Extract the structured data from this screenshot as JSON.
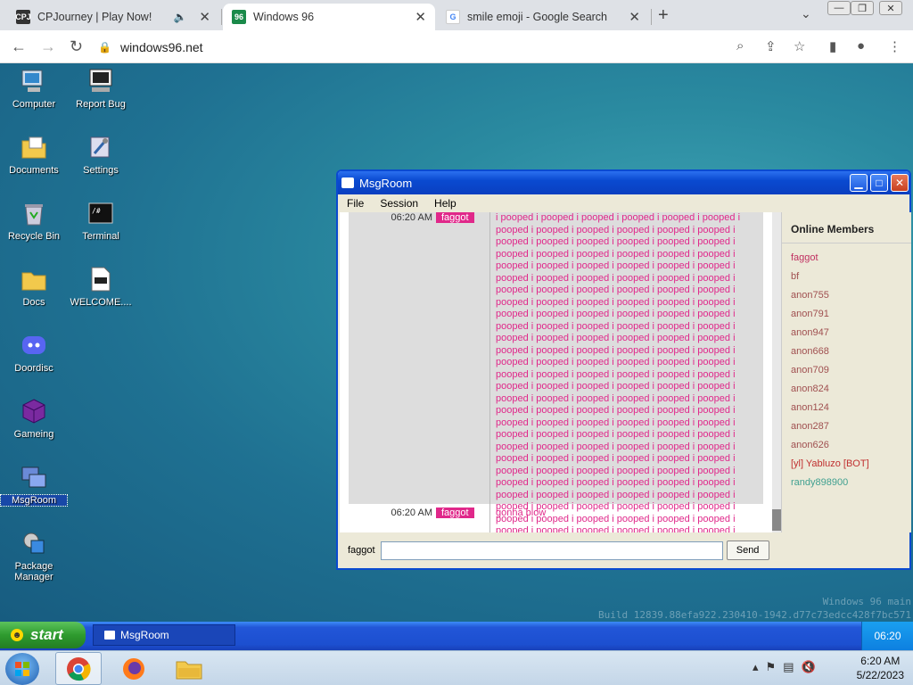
{
  "browser": {
    "tabs": [
      {
        "title": "CPJourney | Play Now!",
        "favicon": "CPJ",
        "audio": true
      },
      {
        "title": "Windows 96",
        "favicon": "96",
        "active": true
      },
      {
        "title": "smile emoji - Google Search",
        "favicon": "G"
      }
    ],
    "url": "windows96.net"
  },
  "desktop": {
    "icons": [
      {
        "label": "Computer"
      },
      {
        "label": "Report Bug"
      },
      {
        "label": "Documents"
      },
      {
        "label": "Settings"
      },
      {
        "label": "Recycle Bin"
      },
      {
        "label": "Terminal"
      },
      {
        "label": "Docs"
      },
      {
        "label": "WELCOME...."
      },
      {
        "label": "Doordisc"
      },
      {
        "label": "Gameing"
      },
      {
        "label": "MsgRoom"
      },
      {
        "label": "Package Manager"
      }
    ],
    "build_line1": "Windows 96 main",
    "build_line2": "Build 12839.88efa922.230410-1942.d77c73edcc428f7bc571"
  },
  "window": {
    "title": "MsgRoom",
    "menu": [
      "File",
      "Session",
      "Help"
    ],
    "messages": [
      {
        "time": "06:20 AM",
        "user": "faggot",
        "text": "i pooped i pooped i pooped i pooped i pooped i pooped i pooped i pooped i pooped i pooped i pooped i pooped i pooped i pooped i pooped i pooped i pooped i pooped i pooped i pooped i pooped i pooped i pooped i pooped i pooped i pooped i pooped i pooped i pooped i pooped i pooped i pooped i pooped i pooped i pooped i pooped i pooped i pooped i pooped i pooped i pooped i pooped i pooped i pooped i pooped i pooped i pooped i pooped i pooped i pooped i pooped i pooped i pooped i pooped i pooped i pooped i pooped i pooped i pooped i pooped i pooped i pooped i pooped i pooped i pooped i pooped i pooped i pooped i pooped i pooped i pooped i pooped i pooped i pooped i pooped i pooped i pooped i pooped i pooped i pooped i pooped i pooped i pooped i pooped i pooped i pooped i pooped i pooped i pooped i pooped i pooped i pooped i pooped i pooped i pooped i pooped i pooped i pooped i pooped i pooped i pooped i pooped i pooped i pooped i pooped i pooped i pooped i pooped i pooped i pooped i pooped i pooped i pooped i pooped i pooped i pooped i pooped i pooped i pooped i pooped i pooped i pooped i pooped i pooped i pooped i pooped i pooped i pooped i pooped i pooped i pooped i pooped i pooped i pooped i pooped i pooped i pooped i pooped i pooped i pooped i pooped i pooped i pooped i pooped i pooped i pooped i pooped i pooped i pooped i pooped i pooped i pooped i pooped i pooped i pooped i pooped i pooped i pooped i pooped i pooped i pooped i pooped i pooped i pooped i pooped i pooped"
      },
      {
        "time": "06:20 AM",
        "user": "faggot",
        "text": "gonna blow"
      }
    ],
    "members_title": "Online Members",
    "members": [
      {
        "name": "faggot",
        "color": "#c03060"
      },
      {
        "name": "bf",
        "color": "#a05050"
      },
      {
        "name": "anon755",
        "color": "#a05050"
      },
      {
        "name": "anon791",
        "color": "#a05050"
      },
      {
        "name": "anon947",
        "color": "#a05050"
      },
      {
        "name": "anon668",
        "color": "#a05050"
      },
      {
        "name": "anon709",
        "color": "#a05050"
      },
      {
        "name": "anon824",
        "color": "#a05050"
      },
      {
        "name": "anon124",
        "color": "#a05050"
      },
      {
        "name": "anon287",
        "color": "#a05050"
      },
      {
        "name": "anon626",
        "color": "#a05050"
      },
      {
        "name": "[yl] Yabluzo [BOT]",
        "color": "#c03030"
      },
      {
        "name": "randy898900",
        "color": "#40a090"
      }
    ],
    "nick_label": "faggot",
    "send_label": "Send"
  },
  "xp_taskbar": {
    "start_label": "start",
    "task": "MsgRoom",
    "clock": "06:20"
  },
  "w7_taskbar": {
    "time": "6:20 AM",
    "date": "5/22/2023"
  }
}
